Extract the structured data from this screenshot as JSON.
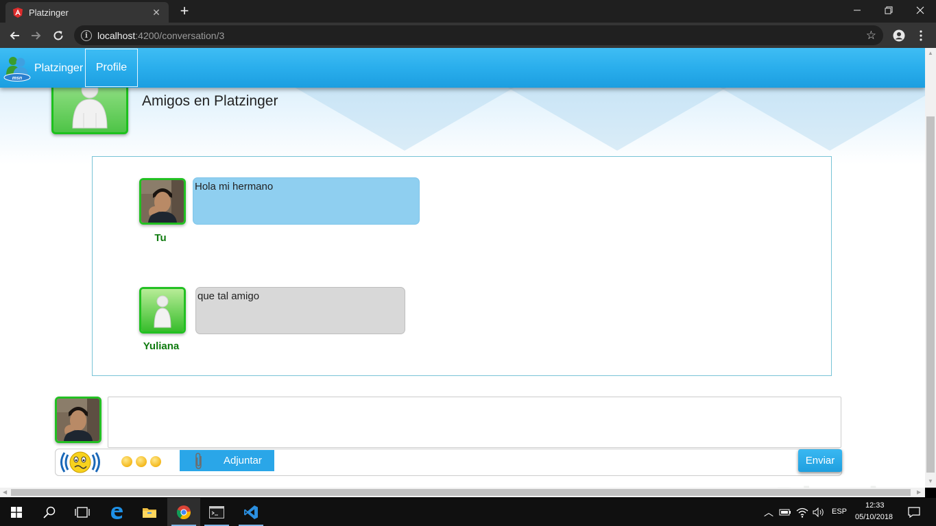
{
  "browser": {
    "tab_title": "Platzinger",
    "tab_close": "✕",
    "new_tab": "+",
    "url_host": "localhost",
    "url_path": ":4200/conversation/3",
    "info_icon_glyph": "i",
    "star_glyph": "☆"
  },
  "navbar": {
    "brand": "Platzinger",
    "profile": "Profile"
  },
  "friend": {
    "heading": "Amigos en Platzinger"
  },
  "messages": [
    {
      "sender": "Tu",
      "text": "Hola mi hermano",
      "style": "me"
    },
    {
      "sender": "Yuliana",
      "text": "que tal amigo",
      "style": "them"
    }
  ],
  "compose": {
    "value": "",
    "attach_label": "Adjuntar",
    "send_label": "Enviar"
  },
  "watermark": "Platzi",
  "taskbar": {
    "language": "ESP",
    "time": "12:33",
    "date": "05/10/2018"
  },
  "colors": {
    "navbar": "#2aaeec",
    "avatar_border": "#22c022",
    "bubble_me": "#8fcff0",
    "bubble_them": "#d8d8d8",
    "sender_name": "#0e7a0e"
  }
}
